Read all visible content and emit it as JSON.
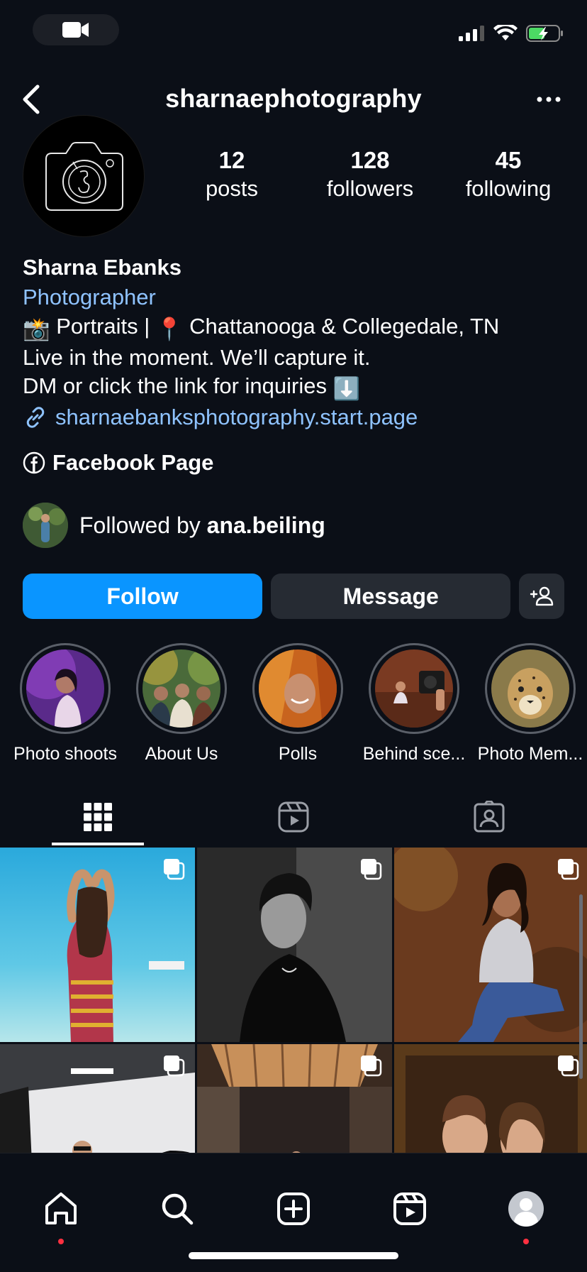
{
  "header": {
    "username": "sharnaephotography"
  },
  "stats": [
    {
      "value": "12",
      "label": "posts"
    },
    {
      "value": "128",
      "label": "followers"
    },
    {
      "value": "45",
      "label": "following"
    }
  ],
  "bio": {
    "name": "Sharna Ebanks",
    "category": "Photographer",
    "line1_emoji_camera": "📸",
    "line1_text_a": " Portraits | ",
    "line1_emoji_pin": "📍",
    "line1_text_b": " Chattanooga & Collegedale, TN",
    "line2": "Live in the moment. We’ll capture it.",
    "line3": "DM or click the link for inquiries ",
    "line3_emoji": "⬇️",
    "link": "sharnaebanksphotography.start.page",
    "facebook": "Facebook Page"
  },
  "followed_by": {
    "prefix": "Followed by ",
    "user": "ana.beiling"
  },
  "buttons": {
    "follow": "Follow",
    "message": "Message"
  },
  "highlights": [
    {
      "label": "Photo shoots"
    },
    {
      "label": "About Us"
    },
    {
      "label": "Polls"
    },
    {
      "label": "Behind sce..."
    },
    {
      "label": "Photo Mem..."
    }
  ],
  "tabs": [
    "grid-icon",
    "reels-icon",
    "tagged-icon"
  ],
  "nav": [
    "home-icon",
    "search-icon",
    "create-icon",
    "reels-icon",
    "profile-icon"
  ],
  "colors": {
    "background": "#0b0f17",
    "follow_button": "#0a95ff",
    "link": "#8fc3ff",
    "notification_dot": "#ff3040"
  }
}
